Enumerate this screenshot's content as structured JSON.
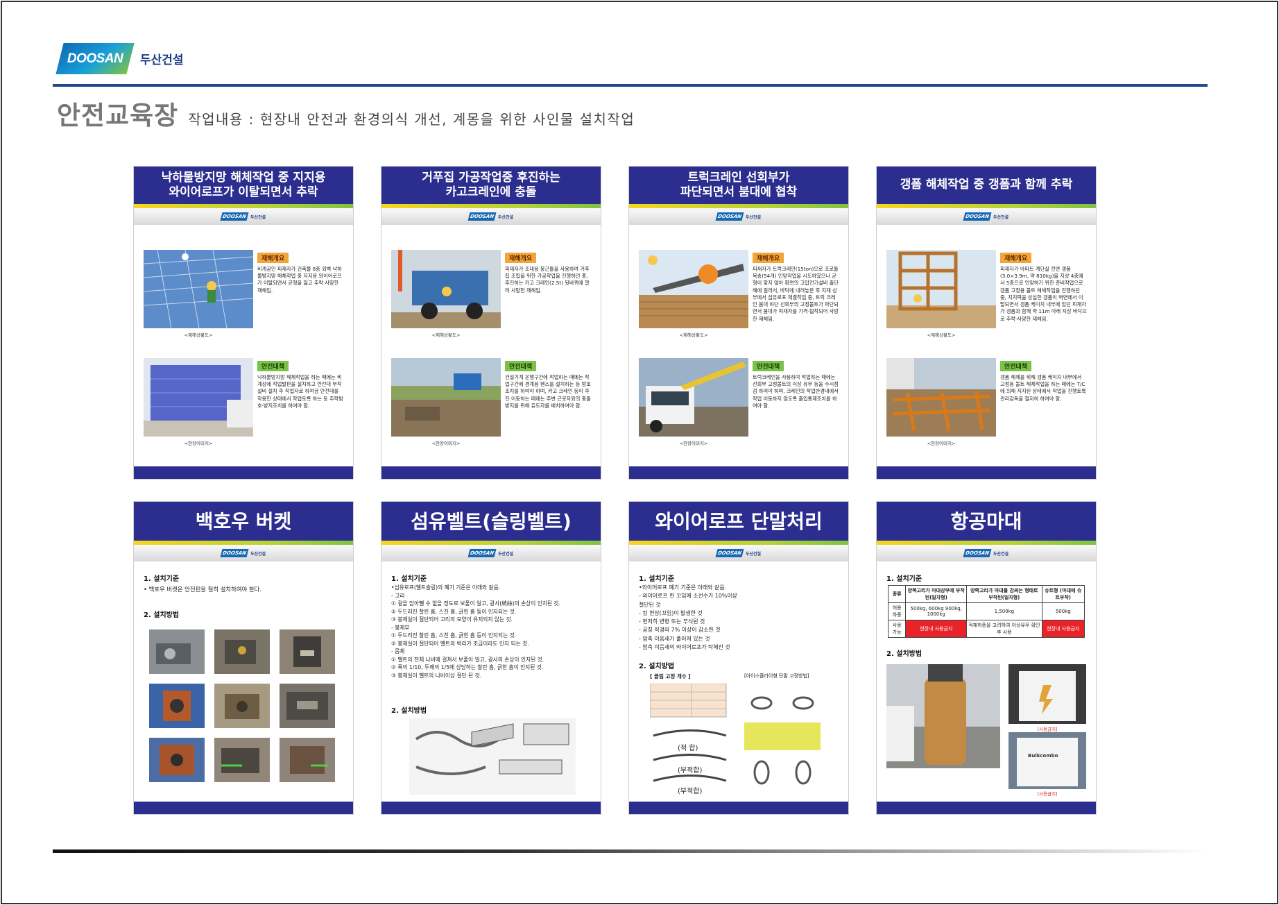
{
  "header": {
    "logo_text": "DOOSAN",
    "logo_korean": "두산건설",
    "title": "안전교육장",
    "subtitle": "작업내용 : 현장내 안전과 환경의식 개선, 계몽을 위한 사인물 설치작업"
  },
  "posters_top": [
    {
      "title_line1": "낙하물방지망 해체작업 중 지지용",
      "title_line2": "와이어로프가 이탈되면서 추락",
      "tag1": "재해개요",
      "text1": "비계공인 피재자가 건축물 8층 외벽 낙하물방지망 해체작업 중 지지용 와이어로프가 이탈되면서 균형을 잃고 추락·사망한 재해임.",
      "cap1": "<재해상황도>",
      "tag2": "안전대책",
      "text2": "낙하물방지망 해체작업을 하는 때에는 비계상에 작업발판을 설치하고 안전대 부착설비 설치 후 작업자로 하여금 안전대를 착용한 상태에서 작업토록 하는 등 추락방호·방지조치를 하여야 함.",
      "cap2": "<현장이미지>"
    },
    {
      "title_line1": "거푸집 가공작업중 후진하는",
      "title_line2": "카고크레인에 충돌",
      "tag1": "재해개요",
      "text1": "피재자가 조대용 붕근틀을 사용하여 거푸집 조립을 위한 가공작업을 진행하던 중, 후진하는 카고 크레인(2.5t) 뒷바퀴에 깔려 사망한 재해임.",
      "cap1": "<재해상황도>",
      "tag2": "안전대책",
      "text2": "건설기계 운행구간에 작업하는 때에는 작업구간에 경계용 펜스를 설치하는 등 방호조치를 하여야 하며, 카고 크레인 등이 후진 이동하는 때에는 주변 근로자와의 충돌방지를 위해 유도자를 배치하여야 함.",
      "cap2": "<현장이미지>"
    },
    {
      "title_line1": "트럭크레인 선회부가",
      "title_line2": "파단되면서 붐대에 협착",
      "tag1": "재해개요",
      "text1": "피재자가 트럭크레인(15ton)으로 조로틀 목송(54개) 인양작업을 시도하였으나 균형이 맞지 않아 확면의 고압전기설비 출단해에 걸려서, 바닥에 내려놓은 후 지재 상부에서 섬유로프 제결작업 중, 트럭 크레인 붐대 하단 선회부의 고정볼트가 파단되면서 붐대가 피재자를 가격·협착되어 사망한 재해임.",
      "cap1": "<재해상황도>",
      "tag2": "안전대책",
      "text2": "트럭크레인을 사용하여 작업하는 때에는 선회부 고정볼트의 이상 유무 등을 수시점검 하여야 하며, 크레인의 작업반경내에서 작업 이동하지 않도록 출입통제조치를 하여야 함.",
      "cap2": "<현장이미지>"
    },
    {
      "title_line1": "갱폼 해체작업 중 갱폼과 함께 추락",
      "title_line2": "",
      "tag1": "재해개요",
      "text1": "피재자가 아파트 계단실 전면 갱폼(3.0×3.9m, 약 810kg)을 지상 4층에서 5층으로 인양하기 위한 준비작업으로 갱폼 고정용 볼트 해체작업을 진행하던 중, 지지력을 상실한 갱폼이 벽면에서 이탈되면서 갱폼 케이지 내부에 있던 피재자가 갱폼과 함께 약 11m 아래 지상 바닥으로 추락·사망한 재해임.",
      "cap1": "<재해상황도>",
      "tag2": "안전대책",
      "text2": "갱폼 해체를 위해 갱폼 케이지 내부에서 고정용 볼트 해체작업을 하는 때에는 T/C에 의해 지지된 상태에서 작업을 진행토록 관리감독을 철저히 하여야 함.",
      "cap2": "<현장이미지>"
    }
  ],
  "posters_bottom": [
    {
      "title": "백호우 버켓",
      "sec1": "1. 설치기준",
      "line1": "• 백호우 버켓은 안전핀을 철히 설치하여야 한다.",
      "sec2": "2. 설치방법"
    },
    {
      "title": "섬유벨트(슬링벨트)",
      "sec1": "1. 설치기준",
      "lines": [
        "•섬유로프(벨트슬링)의 폐기 기준은 아래와 같음.",
        "- 고리",
        "① 겉을 잡아뺄 수 없을 정도로 보풀이 일고, 광사(絖絲)의 손상이 인지된 것.",
        "② 두드러진 찰린 흠, 스친 흠, 긁힌 흠 등이 인지되는 것.",
        "③ 봉제실이 절단되어 고리의 모양이 유지되지 않는 것.",
        "- 봉제부",
        "① 두드러진 찰린 흠, 스친 흠, 긁힌 흠 등이 인지되는 것.",
        "② 봉제실이 절단되어 벨트의 박리가 조금이라도 인지 되는 것.",
        "- 몸체",
        "① 벨트의 전체 나비에 걸쳐서 보풀이 일고, 광사의 손상이 인지된 것.",
        "② 폭의 1/10, 두께의 1/5에 상당하는 찰린 흠, 긁힌 흠이 인지된 것.",
        "③ 봉제실이 벨트의 나비이상 절단 된 것."
      ],
      "sec2": "2. 설치방법"
    },
    {
      "title": "와이어로프 단말처리",
      "sec1": "1. 설치기준",
      "lines": [
        "•와이어로프 폐기 기준은 아래와 같음.",
        "- 와이어로프 한 꼬임에 소선수가 10%이상",
        "  절단된 것",
        "- 킹 현상(꼬임)이 발생한 것",
        "- 현저히 변형 또는 부식된 것",
        "- 공칭 직경의 7% 이상이 감소한 것",
        "- 압축 이음새가 풀어져 있는 것",
        "- 압축 이음새의 와이어로프가 탁해진 것"
      ],
      "sec2": "2. 설치방법",
      "clip_title": "[ 클립 고정 개수 ]",
      "eye_title": "[아이스플라이형 단말 고정방법]",
      "labels": [
        "(적 합)",
        "(부적합)",
        "(부적합)"
      ]
    },
    {
      "title": "항공마대",
      "sec1": "1. 설치기준",
      "table": {
        "headers": [
          "종류",
          "양쪽고리가 마대상부에 부착된(일자형)",
          "양쪽고리가 마대를 감싸는 형태로 부착된(일자형)",
          "슈트형 (마대에 슈트부착)"
        ],
        "row1": [
          "허용 하중",
          "500kg, 600kg 900kg, 1000kg",
          "1,500kg",
          "500kg"
        ],
        "row2": [
          "사용 가능",
          "현장내 사용금지",
          "적재하중을 고려하여 이상유무 확인후 사용",
          "현장내 사용금지"
        ]
      },
      "sec2": "2. 설치방법",
      "caps": [
        "[사용금지]",
        "[사용금지]"
      ],
      "bag_brand": "Bulkcombo"
    }
  ]
}
